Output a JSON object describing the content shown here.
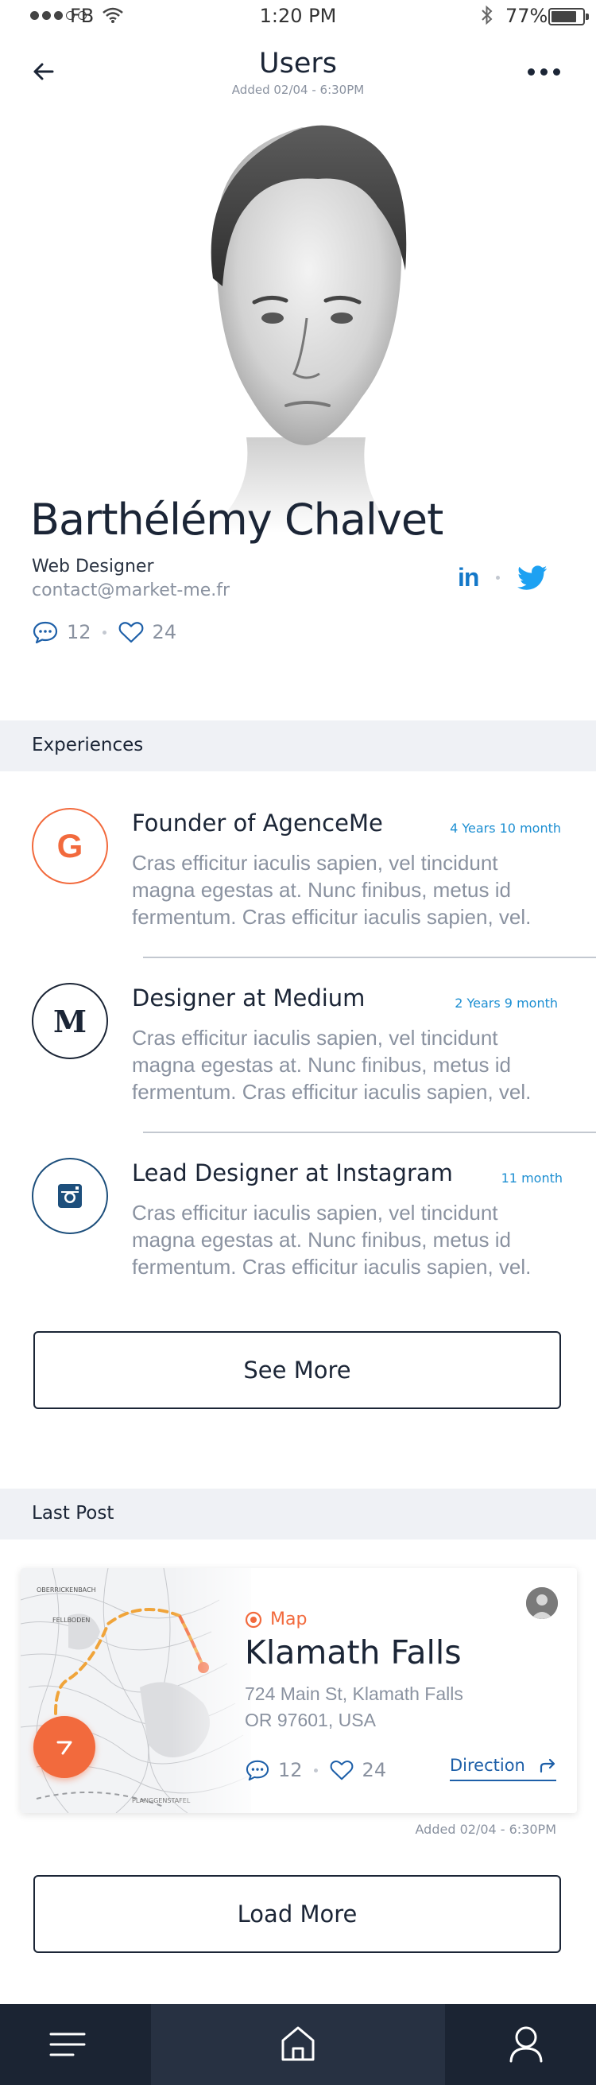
{
  "status_bar": {
    "carrier": "FB",
    "time": "1:20 PM",
    "battery": "77%"
  },
  "header": {
    "title": "Users",
    "subtitle": "Added 02/04 - 6:30PM"
  },
  "profile": {
    "name": "Barthélémy Chalvet",
    "role": "Web Designer",
    "email": "contact@market-me.fr",
    "social": {
      "linkedin": "in"
    },
    "comments": "12",
    "likes": "24"
  },
  "experiences_section": {
    "label": "Experiences",
    "items": [
      {
        "logo_letter": "G",
        "logo_color": "#f26a3d",
        "title": "Founder of AgenceMe",
        "duration": "4 Years 10 month",
        "description": "Cras efficitur iaculis sapien, vel tincidunt magna egestas at. Nunc finibus, metus id fermentum. Cras efficitur iaculis sapien, vel."
      },
      {
        "logo_letter": "M",
        "logo_color": "#1b2536",
        "title": "Designer at Medium",
        "duration": "2 Years 9 month",
        "description": "Cras efficitur iaculis sapien, vel tincidunt magna egestas at. Nunc finibus, metus id fermentum. Cras efficitur iaculis sapien, vel."
      },
      {
        "logo_icon": "instagram-icon",
        "logo_color": "#1d4f7c",
        "title": "Lead Designer at Instagram",
        "duration": "11 month",
        "description": "Cras efficitur iaculis sapien, vel tincidunt magna egestas at. Nunc finibus, metus id fermentum. Cras efficitur iaculis sapien, vel."
      }
    ],
    "see_more": "See More"
  },
  "last_post_section": {
    "label": "Last Post",
    "post": {
      "tag": "Map",
      "title": "Klamath Falls",
      "address_line1": "724 Main St, Klamath Falls",
      "address_line2": "OR 97601, USA",
      "comments": "12",
      "likes": "24",
      "direction": "Direction",
      "added": "Added 02/04 - 6:30PM",
      "map_labels": [
        "OBERRICKENBACH",
        "FELLBODEN",
        "PLANGGENSTAFEL"
      ]
    },
    "load_more": "Load More"
  },
  "tab_bar": {
    "items": [
      "menu-icon",
      "home-icon",
      "profile-icon"
    ],
    "active": "home-icon"
  },
  "colors": {
    "accent": "#f26a3d",
    "link": "#1d8fd2",
    "dark": "#1b2536",
    "twitter": "#1da1f2",
    "linkedin": "#1478c8"
  }
}
